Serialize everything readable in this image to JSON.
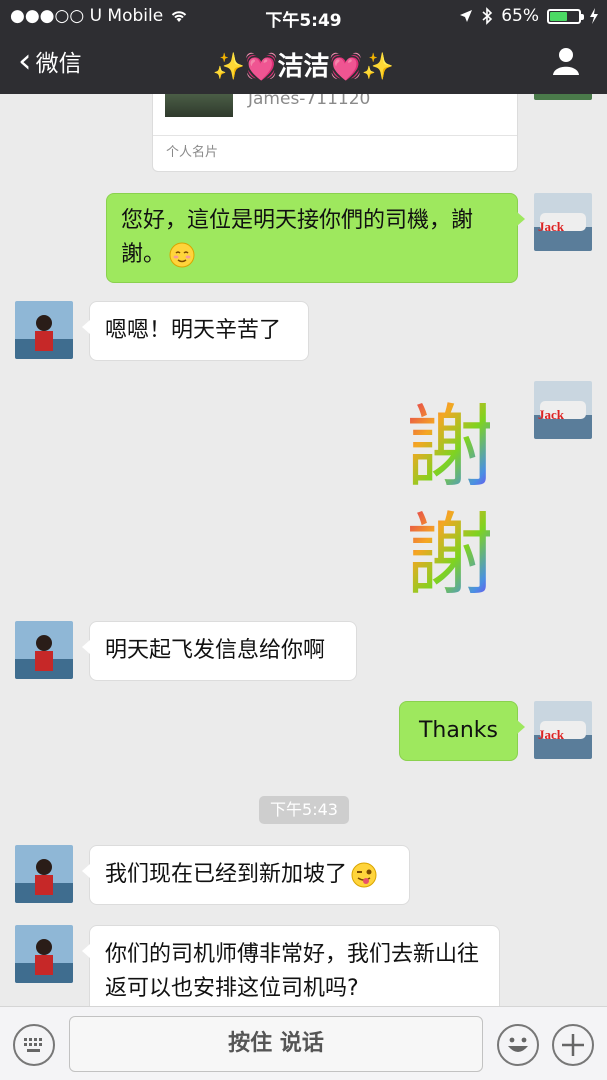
{
  "status_bar": {
    "carrier": "●●●○○ U Mobile",
    "time": "下午5:49",
    "battery_text": "65%",
    "battery_level": 0.65
  },
  "nav": {
    "back_label": "微信",
    "title": "✨💓洁洁💓✨"
  },
  "card": {
    "user_id": "James-711120",
    "kind": "个人名片"
  },
  "messages": [
    {
      "text": "您好，這位是明天接你們的司機，謝謝。"
    },
    {
      "text": "嗯嗯！明天辛苦了"
    },
    {
      "text": "明天起飞发信息给你啊"
    },
    {
      "text": "Thanks"
    },
    {
      "text": "我们现在已经到新加坡了"
    },
    {
      "text": "你们的司机师傅非常好，我们去新山往返可以也安排这位司机吗?"
    }
  ],
  "sticker": {
    "glyphs": [
      "謝",
      "謝"
    ]
  },
  "avatar_badge": "Jack",
  "timestamp": "下午5:43",
  "input": {
    "talk_label": "按住 说话"
  },
  "colors": {
    "header": "#2e2e32",
    "outgoing_bubble": "#9ee85e",
    "chat_bg": "#ebebeb"
  }
}
